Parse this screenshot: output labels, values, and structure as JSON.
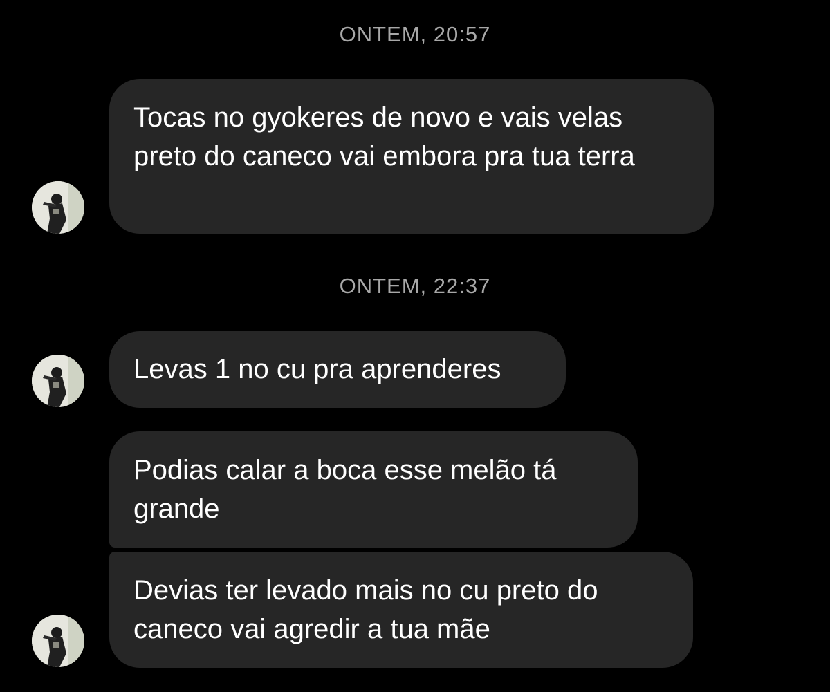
{
  "thread": {
    "groups": [
      {
        "timestamp": "ONTEM, 20:57",
        "messages": [
          {
            "text": "Tocas no gyokeres de novo e vais velas preto do caneco vai embora pra tua terra"
          }
        ]
      },
      {
        "timestamp": "ONTEM, 22:37",
        "messages": [
          {
            "text": "Levas 1 no cu pra aprenderes"
          },
          {
            "text": "Podias calar a boca esse melão tá grande"
          },
          {
            "text": "Devias ter levado mais no cu preto do caneco vai agredir a tua mãe"
          }
        ]
      }
    ]
  },
  "colors": {
    "background": "#000000",
    "bubble": "#262626",
    "timestamp": "#a8a8a8",
    "text": "#ffffff"
  },
  "icons": {
    "avatar": "profile-photo-avatar"
  }
}
